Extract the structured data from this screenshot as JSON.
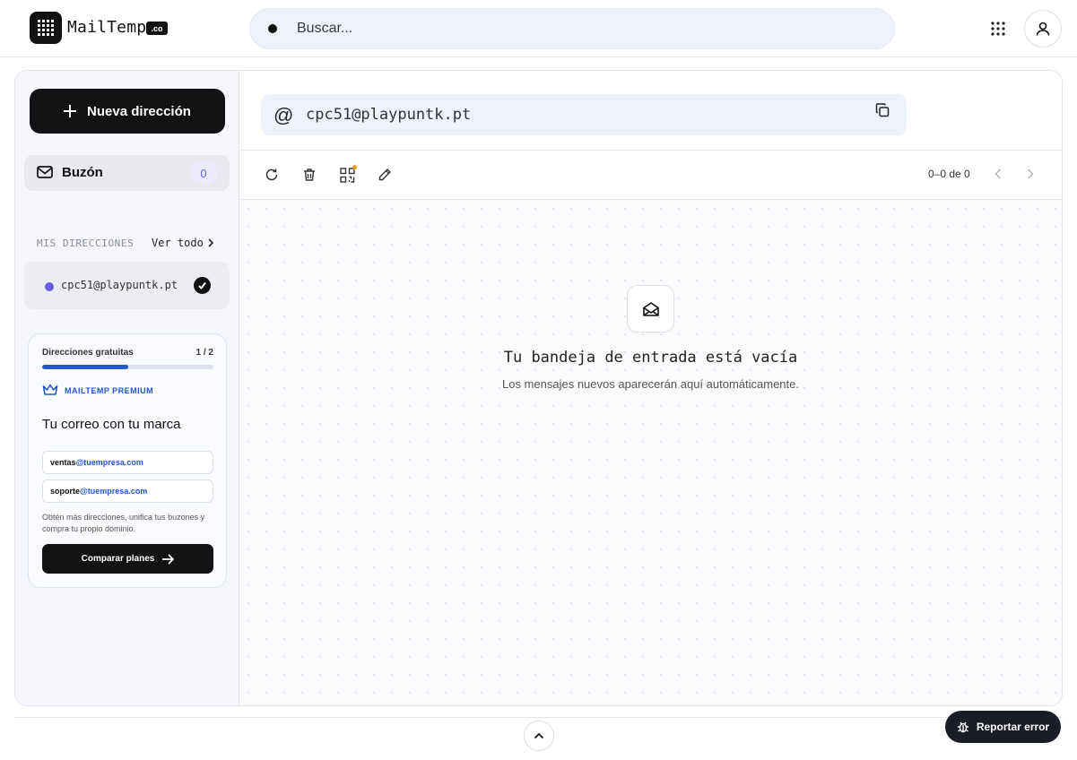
{
  "header": {
    "app_name": "MailTemp",
    "domain_badge": ".co",
    "search_placeholder": "Buscar...",
    "icons": {
      "logo": "grid-dots-icon",
      "apps": "apps-grid-icon",
      "user": "user-icon"
    }
  },
  "sidebar": {
    "new_address_label": "Nueva dirección",
    "inbox_label": "Buzón",
    "inbox_count": "0",
    "addresses_heading": "MIS DIRECCIONES",
    "see_all_label": "Ver todo",
    "addresses": [
      {
        "email": "cpc51@playpuntk.pt",
        "color": "#6c5ce7",
        "selected": true
      }
    ]
  },
  "promo": {
    "free_label": "Direcciones gratuitas",
    "count": "1 / 2",
    "progress": 0.5,
    "premium_label": "MAILTEMP PREMIUM",
    "title": "Tu correo con tu marca",
    "example1_user": "ventas",
    "example1_domain": "@tuempresa.com",
    "example2_user": "soporte",
    "example2_domain": "@tuempresa.com",
    "description": "Obtén más direcciones, unifica tus buzones y compra tu propio dominio.",
    "button_label": "Comparar planes"
  },
  "main": {
    "address": "cpc51@playpuntk.pt",
    "pager_text": "0–0 de 0",
    "empty_title": "Tu bandeja de entrada está vacía",
    "empty_subtitle": "Los mensajes nuevos aparecerán aquí automáticamente."
  },
  "footer": {
    "report_label": "Reportar error"
  },
  "colors": {
    "accent": "#2357c6",
    "address_dot": "#6c5ce7",
    "dark": "#121214",
    "qr_badge": "#f0a020"
  }
}
